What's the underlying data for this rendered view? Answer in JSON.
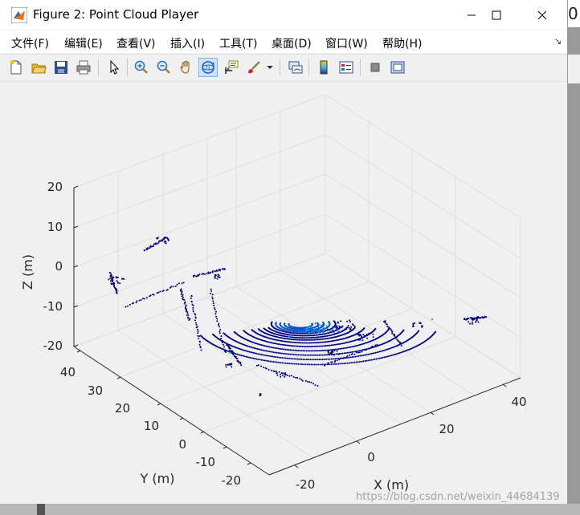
{
  "window": {
    "title": "Figure 2: Point Cloud Player",
    "controls": [
      "minimize-icon",
      "maximize-icon",
      "close-icon"
    ]
  },
  "menubar": {
    "items": [
      "文件(F)",
      "编辑(E)",
      "查看(V)",
      "插入(I)",
      "工具(T)",
      "桌面(D)",
      "窗口(W)",
      "帮助(H)"
    ]
  },
  "toolbar": {
    "icons": [
      "new-figure-icon",
      "open-folder-icon",
      "save-icon",
      "print-icon",
      "pointer-icon",
      "zoom-in-icon",
      "zoom-out-icon",
      "pan-hand-icon",
      "rotate-3d-icon",
      "data-cursor-icon",
      "brush-icon",
      "brush-dropdown-icon",
      "link-plot-icon",
      "colorbar-icon",
      "legend-icon",
      "hide-plot-tools-icon",
      "show-plot-tools-icon"
    ],
    "active": "rotate-3d-icon"
  },
  "plot": {
    "x_label": "X (m)",
    "y_label": "Y (m)",
    "z_label": "Z (m)",
    "x_ticks": [
      "-20",
      "0",
      "20",
      "40"
    ],
    "y_ticks": [
      "-20",
      "-10",
      "0",
      "10",
      "20",
      "30",
      "40"
    ],
    "z_ticks": [
      "20",
      "10",
      "0",
      "-10",
      "-20"
    ],
    "colors": {
      "near": "#000080",
      "mid": "#0050c8",
      "far": "#00a0e8",
      "accent": "#33cc66"
    }
  },
  "bg_window_peek": "0",
  "watermark": "https://blog.csdn.net/weixin_44684139"
}
